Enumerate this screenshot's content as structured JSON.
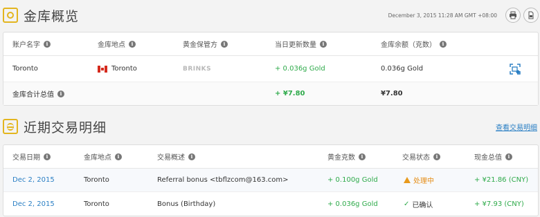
{
  "overview": {
    "title": "金库概览",
    "timestamp": "December 3, 2015 11:28 AM GMT +08:00",
    "headers": [
      "账户名字",
      "金库地点",
      "黄金保管方",
      "当日更新数量",
      "金库余额（克数）"
    ],
    "rows": [
      {
        "account": "Toronto",
        "location": "Toronto",
        "custodian": "BRINKS",
        "update": "+ 0.036g Gold",
        "balance": "0.036g Gold"
      }
    ],
    "total": {
      "label": "金库合计总值",
      "update": "+ ¥7.80",
      "balance": "¥7.80"
    }
  },
  "transactions": {
    "title": "近期交易明细",
    "view_all": "查看交易明细",
    "headers": [
      "交易日期",
      "金库地点",
      "交易概述",
      "黄金克数",
      "交易状态",
      "现金总值"
    ],
    "rows": [
      {
        "date": "Dec 2, 2015",
        "location": "Toronto",
        "summary": "Referral bonus <tbflzcom@163.com>",
        "grams": "+ 0.100g Gold",
        "status": "处理中",
        "value": "+ ¥21.86 (CNY)"
      },
      {
        "date": "Dec 2, 2015",
        "location": "Toronto",
        "summary": "Bonus (Birthday)",
        "grams": "+ 0.036g Gold",
        "status": "已确认",
        "value": "+ ¥7.93 (CNY)"
      }
    ]
  },
  "colors": {
    "accent_gold": "#e3b51e",
    "positive": "#2eaa4a",
    "link": "#2a7fc4",
    "pending": "#e58c14"
  }
}
